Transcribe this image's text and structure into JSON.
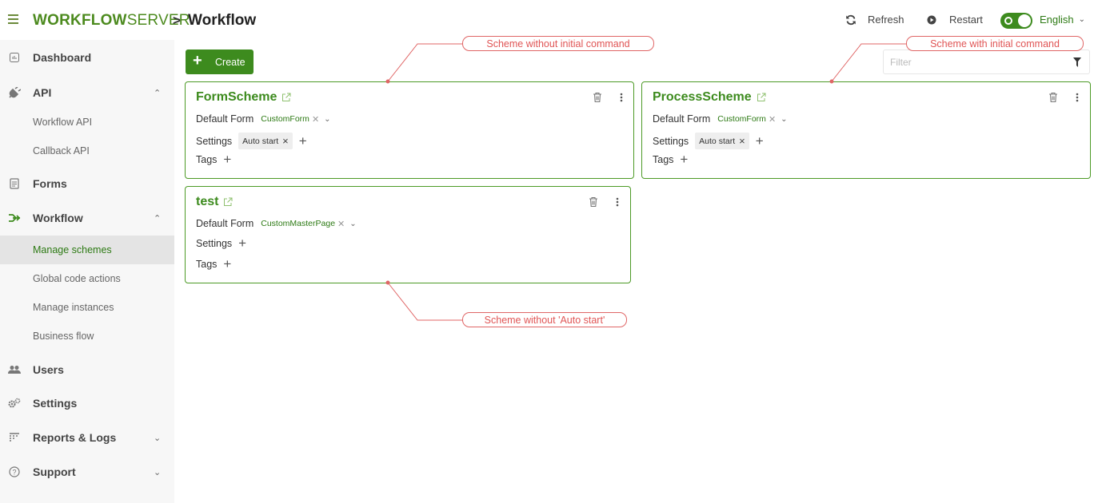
{
  "header": {
    "logo_bold": "WORKFLOW",
    "logo_light": "SERVER",
    "breadcrumb_separator": ">",
    "title": "Workflow",
    "refresh_label": "Refresh",
    "restart_label": "Restart",
    "language": "English"
  },
  "sidebar": {
    "items": [
      {
        "label": "Dashboard",
        "icon": "dashboard-icon"
      },
      {
        "label": "API",
        "icon": "plug-icon",
        "expanded": true,
        "children": [
          "Workflow API",
          "Callback API"
        ]
      },
      {
        "label": "Forms",
        "icon": "forms-icon"
      },
      {
        "label": "Workflow",
        "icon": "workflow-icon",
        "expanded": true,
        "children": [
          "Manage schemes",
          "Global code actions",
          "Manage instances",
          "Business flow"
        ],
        "active_child": "Manage schemes"
      },
      {
        "label": "Users",
        "icon": "users-icon"
      },
      {
        "label": "Settings",
        "icon": "gears-icon"
      },
      {
        "label": "Reports & Logs",
        "icon": "reports-icon",
        "expanded": false
      },
      {
        "label": "Support",
        "icon": "help-icon",
        "expanded": false
      }
    ]
  },
  "toolbar": {
    "create_label": "Create",
    "filter_placeholder": "Filter"
  },
  "schemes": [
    {
      "name": "FormScheme",
      "default_form_label": "Default Form",
      "default_form": "CustomForm",
      "settings_label": "Settings",
      "settings_tags": [
        "Auto start"
      ],
      "tags_label": "Tags"
    },
    {
      "name": "ProcessScheme",
      "default_form_label": "Default Form",
      "default_form": "CustomForm",
      "settings_label": "Settings",
      "settings_tags": [
        "Auto start"
      ],
      "tags_label": "Tags"
    },
    {
      "name": "test",
      "default_form_label": "Default Form",
      "default_form": "CustomMasterPage",
      "settings_label": "Settings",
      "settings_tags": [],
      "tags_label": "Tags"
    }
  ],
  "annotations": {
    "without_initial": "Scheme without initial command",
    "with_initial": "Scheme with initial command",
    "without_autostart": "Scheme without 'Auto start'"
  },
  "colors": {
    "brand_green": "#3d8b1e",
    "annotation_red": "#e05555"
  }
}
